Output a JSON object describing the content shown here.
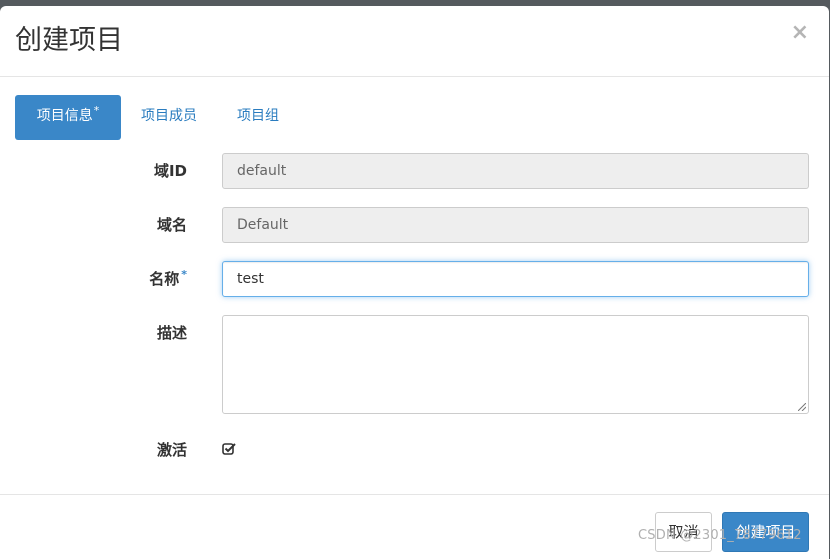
{
  "dialog": {
    "title": "创建项目",
    "close_symbol": "×"
  },
  "tabs": [
    {
      "label": "项目信息",
      "required_mark": "*",
      "active": true
    },
    {
      "label": "项目成员",
      "active": false
    },
    {
      "label": "项目组",
      "active": false
    }
  ],
  "form": {
    "domain_id": {
      "label": "域ID",
      "value": "default"
    },
    "domain_name": {
      "label": "域名",
      "value": "Default"
    },
    "name": {
      "label": "名称",
      "required_mark": "*",
      "value": "test"
    },
    "description": {
      "label": "描述",
      "value": ""
    },
    "enabled": {
      "label": "激活",
      "checked": true
    }
  },
  "footer": {
    "cancel_label": "取消",
    "create_label": "创建项目"
  },
  "watermark": "CSDN @2301_78779612",
  "colors": {
    "primary": "#3a87c8",
    "link": "#2a7cbf",
    "disabled_bg": "#eeeeee",
    "focus_border": "#66afe9"
  }
}
